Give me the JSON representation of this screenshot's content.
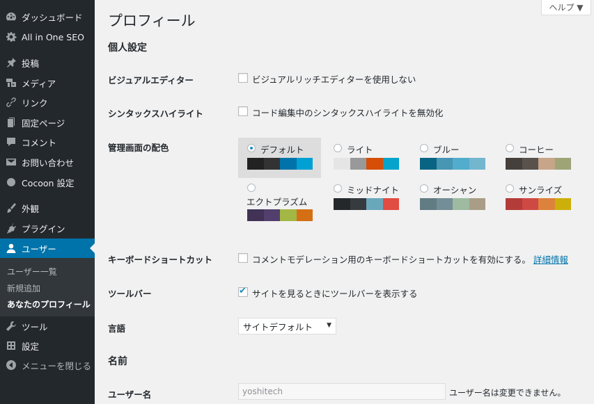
{
  "sidebar": {
    "items": [
      {
        "label": "ダッシュボード",
        "icon": "dashboard-icon"
      },
      {
        "label": "All in One SEO",
        "icon": "gear-icon"
      },
      {
        "label": "投稿",
        "icon": "pin-icon"
      },
      {
        "label": "メディア",
        "icon": "media-icon"
      },
      {
        "label": "リンク",
        "icon": "link-icon"
      },
      {
        "label": "固定ページ",
        "icon": "page-icon"
      },
      {
        "label": "コメント",
        "icon": "comment-icon"
      },
      {
        "label": "お問い合わせ",
        "icon": "mail-icon"
      },
      {
        "label": "Cocoon 設定",
        "icon": "circle-icon"
      },
      {
        "label": "外観",
        "icon": "brush-icon"
      },
      {
        "label": "プラグイン",
        "icon": "plugin-icon"
      },
      {
        "label": "ユーザー",
        "icon": "user-icon"
      },
      {
        "label": "ツール",
        "icon": "wrench-icon"
      },
      {
        "label": "設定",
        "icon": "settings-icon"
      },
      {
        "label": "メニューを閉じる",
        "icon": "collapse-icon"
      }
    ],
    "submenu": [
      "ユーザー一覧",
      "新規追加",
      "あなたのプロフィール"
    ]
  },
  "header": {
    "title": "プロフィール",
    "help": "ヘルプ ▼"
  },
  "sections": {
    "personal": "個人設定",
    "name": "名前"
  },
  "rows": {
    "visual_editor": {
      "label": "ビジュアルエディター",
      "checkbox": "ビジュアルリッチエディターを使用しない",
      "checked": false
    },
    "syntax": {
      "label": "シンタックスハイライト",
      "checkbox": "コード編集中のシンタックスハイライトを無効化",
      "checked": false
    },
    "color_scheme": {
      "label": "管理画面の配色"
    },
    "keyboard": {
      "label": "キーボードショートカット",
      "checkbox": "コメントモデレーション用のキーボードショートカットを有効にする。",
      "link": "詳細情報",
      "checked": false
    },
    "toolbar": {
      "label": "ツールバー",
      "checkbox": "サイトを見るときにツールバーを表示する",
      "checked": true
    },
    "language": {
      "label": "言語",
      "value": "サイトデフォルト"
    },
    "username": {
      "label": "ユーザー名",
      "value": "yoshitech",
      "desc": "ユーザー名は変更できません。"
    }
  },
  "schemes": [
    {
      "name": "デフォルト",
      "selected": true,
      "colors": [
        "#222222",
        "#333333",
        "#0073aa",
        "#00a0d2"
      ]
    },
    {
      "name": "ライト",
      "selected": false,
      "colors": [
        "#e5e5e5",
        "#999999",
        "#d64e07",
        "#04a4cc"
      ]
    },
    {
      "name": "ブルー",
      "selected": false,
      "colors": [
        "#096484",
        "#4796b3",
        "#52accc",
        "#74b6ce"
      ]
    },
    {
      "name": "コーヒー",
      "selected": false,
      "colors": [
        "#46403c",
        "#59524c",
        "#c7a589",
        "#9ea476"
      ]
    },
    {
      "name": "エクトプラズム",
      "selected": false,
      "colors": [
        "#413256",
        "#523f6d",
        "#a3b745",
        "#d46f15"
      ]
    },
    {
      "name": "ミッドナイト",
      "selected": false,
      "colors": [
        "#25282b",
        "#363b3f",
        "#69a8bb",
        "#e14d43"
      ]
    },
    {
      "name": "オーシャン",
      "selected": false,
      "colors": [
        "#627c83",
        "#738e96",
        "#9ebaa0",
        "#aa9d88"
      ]
    },
    {
      "name": "サンライズ",
      "selected": false,
      "colors": [
        "#b43c38",
        "#cf4944",
        "#dd823b",
        "#ccaf0b"
      ]
    }
  ],
  "colors": {
    "accent": "#0073aa",
    "sidebar_bg": "#23282d",
    "page_bg": "#f1f1f1"
  }
}
